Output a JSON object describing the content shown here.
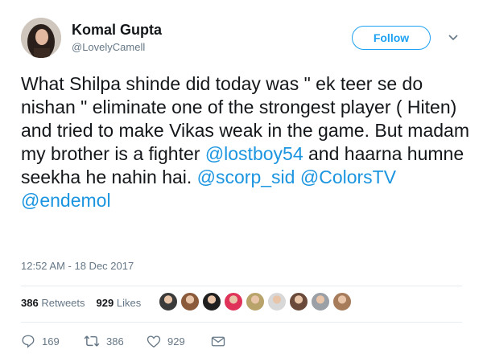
{
  "user": {
    "display_name": "Komal Gupta",
    "handle": "@LovelyCamell"
  },
  "follow_label": "Follow",
  "tweet": {
    "text_segments": [
      {
        "t": "What Shilpa shinde did today was \" ek teer se do nishan \" eliminate one of the strongest player ( Hiten) and tried to make Vikas weak in the game. But madam my brother is a fighter ",
        "mention": false
      },
      {
        "t": "@lostboy54",
        "mention": true
      },
      {
        "t": " and haarna humne seekha he nahin hai. ",
        "mention": false
      },
      {
        "t": "@scorp_sid",
        "mention": true
      },
      {
        "t": " ",
        "mention": false
      },
      {
        "t": "@ColorsTV",
        "mention": true
      },
      {
        "t": " ",
        "mention": false
      },
      {
        "t": "@endemol",
        "mention": true
      }
    ],
    "timestamp": "12:52 AM - 18 Dec 2017"
  },
  "stats": {
    "retweets_count": "386",
    "retweets_label": "Retweets",
    "likes_count": "929",
    "likes_label": "Likes"
  },
  "liker_avatars": [
    "#3b3b3b",
    "#8a5a3a",
    "#1f1f1f",
    "#e0335a",
    "#b8a36a",
    "#d8d8d8",
    "#6a4a3a",
    "#9aa0a6",
    "#a67c5b"
  ],
  "actions": {
    "reply_count": "169",
    "retweet_count": "386",
    "like_count": "929"
  },
  "colors": {
    "accent": "#1da1f2",
    "mention": "#1b95e0",
    "muted": "#657786"
  },
  "icons": {
    "reply": "reply-icon",
    "retweet": "retweet-icon",
    "like": "heart-icon",
    "dm": "envelope-icon",
    "caret": "chevron-down-icon"
  }
}
